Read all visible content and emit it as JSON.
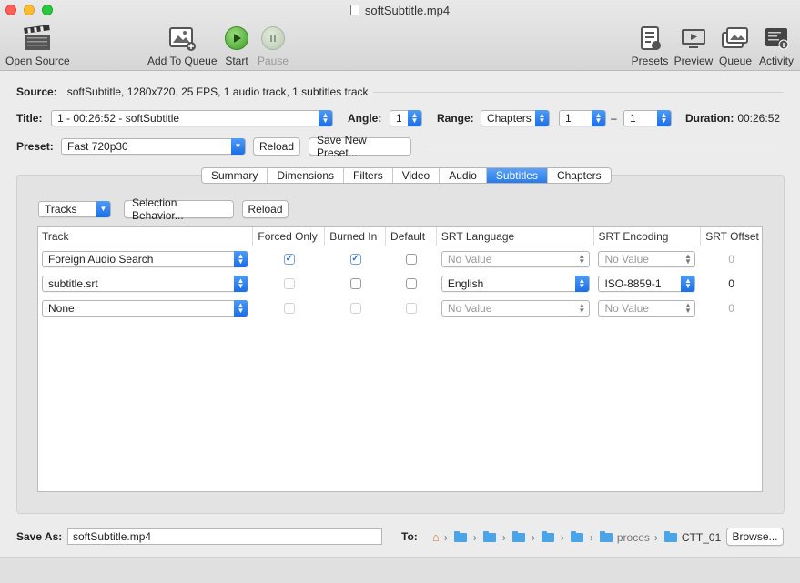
{
  "window": {
    "title": "softSubtitle.mp4"
  },
  "toolbar": {
    "open_source": "Open Source",
    "add_to_queue": "Add To Queue",
    "start": "Start",
    "pause": "Pause",
    "presets": "Presets",
    "preview": "Preview",
    "queue": "Queue",
    "activity": "Activity"
  },
  "source": {
    "label": "Source:",
    "value": "softSubtitle, 1280x720, 25 FPS, 1 audio track, 1 subtitles track"
  },
  "title_row": {
    "title_label": "Title:",
    "title_value": "1 - 00:26:52 - softSubtitle",
    "angle_label": "Angle:",
    "angle_value": "1",
    "range_label": "Range:",
    "range_mode": "Chapters",
    "range_from": "1",
    "range_dash": "–",
    "range_to": "1",
    "duration_label": "Duration:",
    "duration_value": "00:26:52"
  },
  "preset_row": {
    "label": "Preset:",
    "value": "Fast 720p30",
    "reload": "Reload",
    "save_new": "Save New Preset..."
  },
  "tabs": [
    "Summary",
    "Dimensions",
    "Filters",
    "Video",
    "Audio",
    "Subtitles",
    "Chapters"
  ],
  "active_tab": "Subtitles",
  "subtitles": {
    "tracks_popup": "Tracks",
    "selection_behavior": "Selection Behavior...",
    "reload": "Reload",
    "columns": [
      "Track",
      "Forced Only",
      "Burned In",
      "Default",
      "SRT Language",
      "SRT Encoding",
      "SRT Offset"
    ],
    "rows": [
      {
        "track": "Foreign Audio Search",
        "forced": true,
        "forced_enabled": true,
        "burned": true,
        "burned_enabled": true,
        "default": false,
        "default_enabled": true,
        "lang": "No Value",
        "enc": "No Value",
        "offset": "0",
        "srt_enabled": false
      },
      {
        "track": "subtitle.srt",
        "forced": false,
        "forced_enabled": false,
        "burned": false,
        "burned_enabled": true,
        "default": false,
        "default_enabled": true,
        "lang": "English",
        "enc": "ISO-8859-1",
        "offset": "0",
        "srt_enabled": true
      },
      {
        "track": "None",
        "forced": false,
        "forced_enabled": false,
        "burned": false,
        "burned_enabled": false,
        "default": false,
        "default_enabled": false,
        "lang": "No Value",
        "enc": "No Value",
        "offset": "0",
        "srt_enabled": false
      }
    ]
  },
  "save": {
    "label": "Save As:",
    "value": "softSubtitle.mp4",
    "to_label": "To:",
    "path_folder": "proces",
    "path_last": "CTT_01",
    "browse": "Browse..."
  }
}
